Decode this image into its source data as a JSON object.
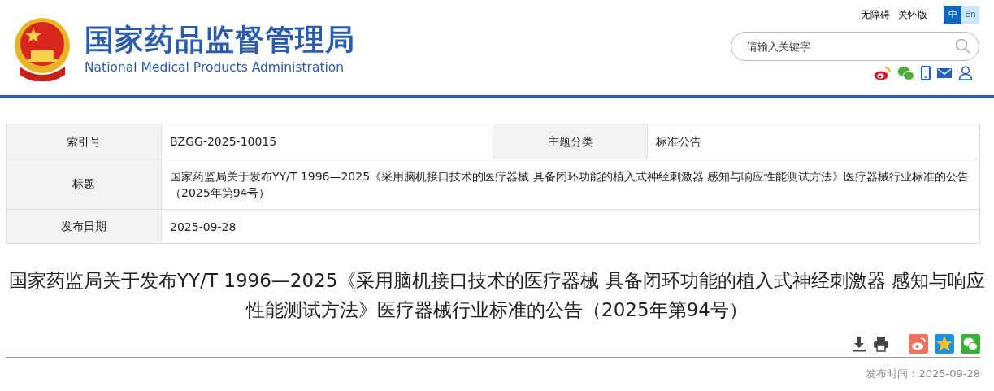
{
  "header": {
    "site_title": "国家药品监督管理局",
    "site_subtitle": "National Medical Products Administration",
    "top_links": [
      "无障碍",
      "关怀版"
    ],
    "languages": [
      {
        "label": "中",
        "selected": true
      },
      {
        "label": "En",
        "selected": false
      }
    ],
    "search": {
      "placeholder": "请输入关键字"
    }
  },
  "info_table": {
    "rows": [
      {
        "cells": [
          {
            "label": "索引号",
            "value": "BZGG-2025-10015"
          },
          {
            "label": "主题分类",
            "value": "标准公告"
          }
        ]
      },
      {
        "cells": [
          {
            "label": "标题",
            "value": "国家药监局关于发布YY/T 1996—2025《采用脑机接口技术的医疗器械 具备闭环功能的植入式神经刺激器 感知与响应性能测试方法》医疗器械行业标准的公告（2025年第94号）"
          }
        ]
      },
      {
        "cells": [
          {
            "label": "发布日期",
            "value": "2025-09-28"
          }
        ]
      }
    ]
  },
  "article": {
    "title": "国家药监局关于发布YY/T 1996—2025《采用脑机接口技术的医疗器械 具备闭环功能的植入式神经刺激器 感知与响应性能测试方法》医疗器械行业标准的公告（2025年第94号）",
    "publish_time": "发布时间：2025-09-28"
  }
}
